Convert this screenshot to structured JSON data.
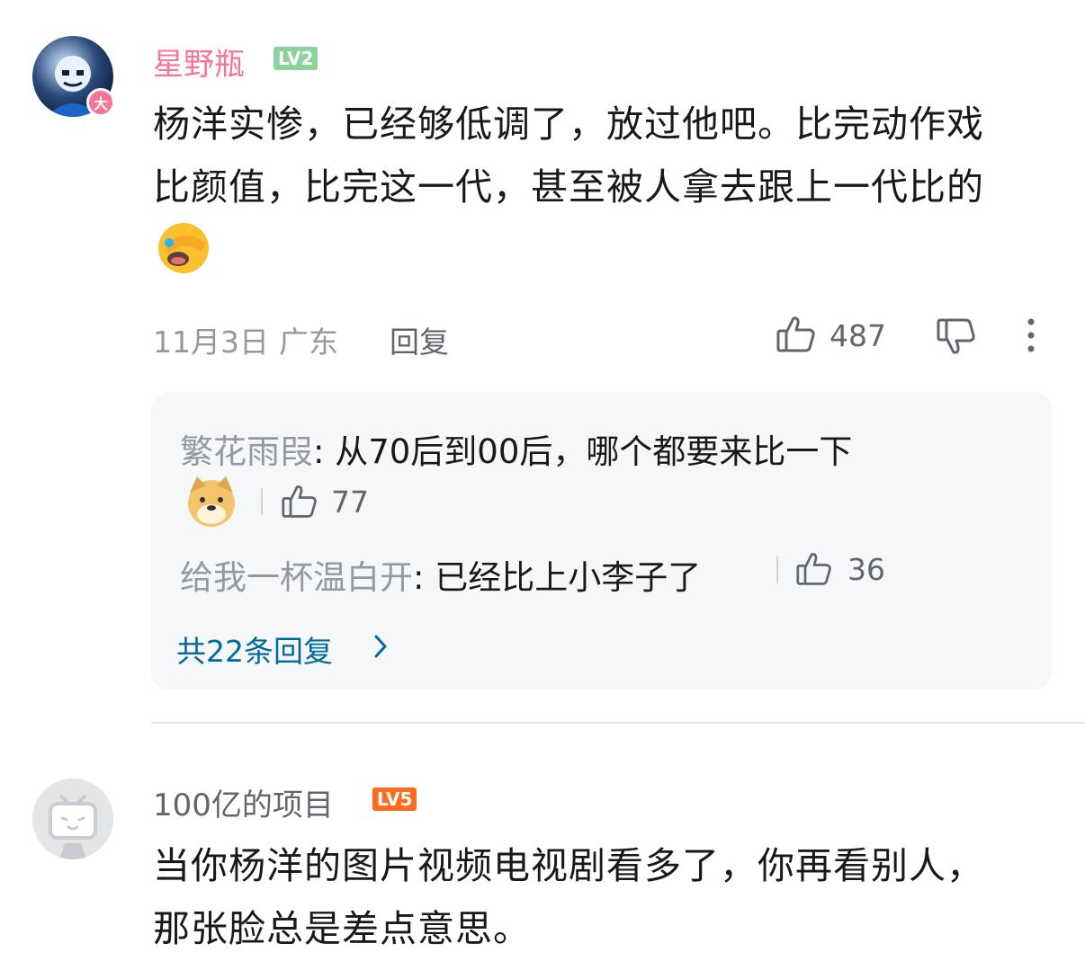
{
  "comments": [
    {
      "user": {
        "name": "星野瓶",
        "level": "LV2",
        "name_color": "#fb7299",
        "level_color": "#8bd29b",
        "avatar_badge": "大"
      },
      "text_line1": "杨洋实惨，已经够低调了，放过他吧。比完动作戏",
      "text_line2": "比颜值，比完这一代，甚至被人拿去跟上一代比的",
      "emoji": "face-palm-emoji",
      "date": "11月3日",
      "location": "广东",
      "reply_label": "回复",
      "likes": "487",
      "replies": [
        {
          "name": "繁花雨叚",
          "text": ": 从70后到00后，哪个都要来比一下",
          "likes": "77",
          "emoji": "doge-emoji"
        },
        {
          "name": "给我一杯温白开",
          "text": ": 已经比上小李子了",
          "likes": "36"
        }
      ],
      "more_replies": "共22条回复"
    },
    {
      "user": {
        "name": "100亿的项目",
        "level": "LV5",
        "name_color": "#61666d",
        "level_color": "#ff6b1a"
      },
      "text_line1": "当你杨洋的图片视频电视剧看多了，你再看别人，",
      "text_line2": "那张脸总是差点意思。"
    }
  ],
  "icons": [
    "thumbs-up-icon",
    "thumbs-down-icon",
    "more-icon",
    "chevron-right-icon",
    "tv-icon"
  ]
}
